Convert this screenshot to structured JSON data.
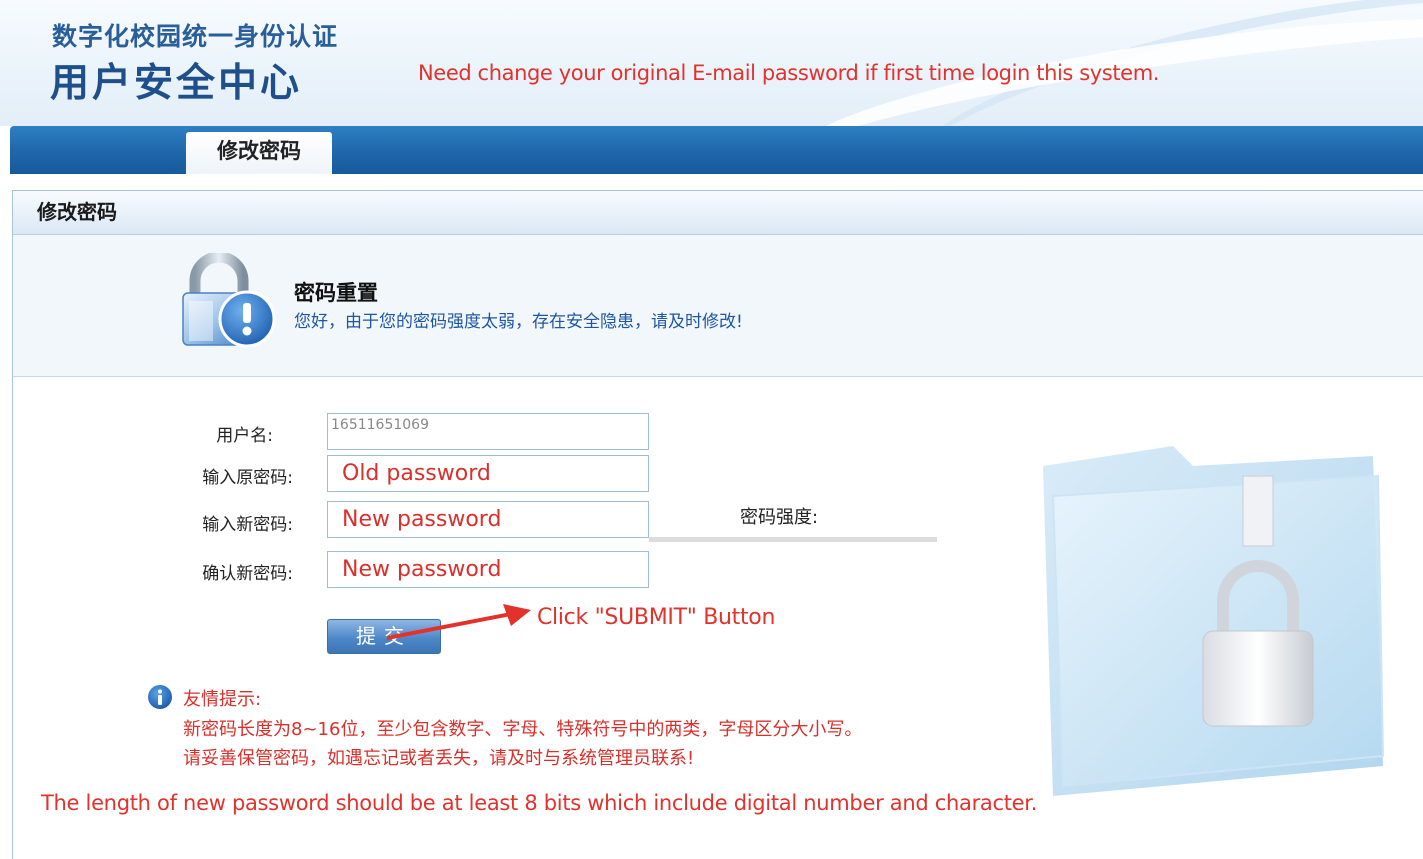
{
  "header": {
    "subtitle": "数字化校园统一身份认证",
    "title": "用户安全中心",
    "note": "Need change your original E-mail password if first time login this system."
  },
  "nav": {
    "tabs": [
      {
        "label": "修改密码",
        "active": true
      }
    ]
  },
  "panel": {
    "title": "修改密码",
    "notice": {
      "title": "密码重置",
      "text": "您好，由于您的密码强度太弱，存在安全隐患，请及时修改!"
    }
  },
  "form": {
    "username_label": "用户名:",
    "username_value": "16511651069",
    "old_password_label": "输入原密码:",
    "old_password_value": "Old password",
    "new_password_label": "输入新密码:",
    "new_password_value": "New password",
    "confirm_password_label": "确认新密码:",
    "confirm_password_value": "New password",
    "strength_label": "密码强度:",
    "submit_label": "提交"
  },
  "annotation": {
    "text": "Click \"SUBMIT\" Button"
  },
  "tips": {
    "title": "友情提示:",
    "lines": [
      "新密码长度为8~16位，至少包含数字、字母、特殊符号中的两类，字母区分大小写。",
      "请妥善保管密码，如遇忘记或者丢失，请及时与系统管理员联系!"
    ],
    "note": "The length of new password should be at least 8 bits which include digital number and character."
  },
  "colors": {
    "brand": "#1f4f8a",
    "nav_blue": "#1f66aa",
    "annotation_red": "#e2322b",
    "notice_blue": "#1f55a5"
  },
  "icons": {
    "notice": "padlock-warning-icon",
    "tips": "info-icon",
    "illustration": "folder-lock-icon"
  }
}
